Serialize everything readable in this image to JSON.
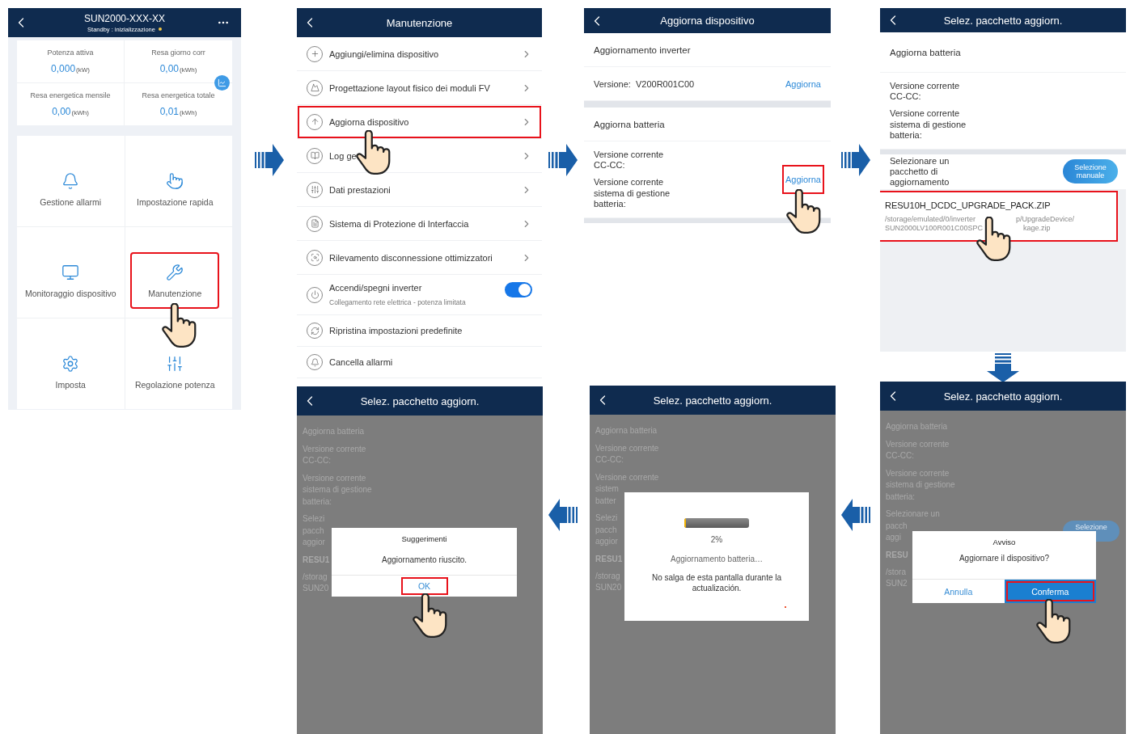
{
  "top_screens": [
    {
      "kind": "home",
      "title": "SUN2000-XXX-XX",
      "subtitle": "Standby : inizializzazione",
      "stats": [
        {
          "label": "Potenza attiva",
          "value": "0,000",
          "unit": "(kW)"
        },
        {
          "label": "Resa giorno corr",
          "value": "0,00",
          "unit": "(kWh)"
        },
        {
          "label": "Resa energetica mensile",
          "value": "0,00",
          "unit": "(kWh)"
        },
        {
          "label": "Resa energetica totale",
          "value": "0,01",
          "unit": "(kWh)"
        }
      ],
      "tiles": [
        {
          "label": "Gestione allarmi",
          "highlighted": false
        },
        {
          "label": "Impostazione rapida",
          "highlighted": false
        },
        {
          "label": "Monitoraggio dispositivo",
          "highlighted": false
        },
        {
          "label": "Manutenzione",
          "highlighted": true
        },
        {
          "label": "Imposta",
          "highlighted": false
        },
        {
          "label": "Regolazione potenza",
          "highlighted": false
        }
      ]
    },
    {
      "kind": "menu",
      "title": "Manutenzione",
      "items": [
        {
          "kind": "link",
          "label": "Aggiungi/elimina dispositivo",
          "highlighted": false
        },
        {
          "kind": "link",
          "label": "Progettazione layout fisico dei moduli FV",
          "highlighted": false
        },
        {
          "kind": "link",
          "label": "Aggiorna dispositivo",
          "highlighted": true
        },
        {
          "kind": "link",
          "label": "Log ge",
          "highlighted": false
        },
        {
          "kind": "link",
          "label": "Dati prestazioni",
          "highlighted": false
        },
        {
          "kind": "link",
          "label": "Sistema di Protezione di Interfaccia",
          "highlighted": false
        },
        {
          "kind": "link",
          "label": "Rilevamento disconnessione ottimizzatori",
          "highlighted": false
        },
        {
          "kind": "toggle",
          "label": "Accendi/spegni inverter",
          "sublabel": "Collegamento rete elettrica - potenza limitata",
          "on": true
        },
        {
          "kind": "plain",
          "label": "Ripristina impostazioni predefinite",
          "highlighted": false
        },
        {
          "kind": "plain",
          "label": "Cancella allarmi",
          "highlighted": false
        }
      ]
    },
    {
      "kind": "update",
      "title": "Aggiorna dispositivo",
      "inverter": {
        "heading": "Aggiornamento inverter",
        "version": "Versione:  V200R001C00",
        "action": "Aggiorna",
        "highlighted": false
      },
      "battery": {
        "heading": "Aggiorna batteria",
        "versions": [
          "Versione corrente CC-CC:",
          "Versione corrente sistema di gestione batteria:"
        ],
        "action": "Aggiorna",
        "highlighted": true
      }
    },
    {
      "kind": "package",
      "title": "Selez. pacchetto aggiorn.",
      "heading": "Aggiorna batteria",
      "versions": [
        "Versione corrente CC-CC:",
        "Versione corrente sistema di gestione batteria:"
      ],
      "prompt": "Selezionare un pacchetto di aggiornamento",
      "button": "Selezione manuale",
      "file": {
        "name": "RESU10H_DCDC_UPGRADE_PACK.ZIP",
        "path_lines": [
          [
            "/storage/emulated/0/inverter",
            "p/UpgradeDevice/"
          ],
          [
            "SUN2000LV100R001C00SPC",
            "kage.zip"
          ]
        ],
        "highlighted": true
      }
    }
  ],
  "bottom_screens": [
    {
      "title": "Selez. pacchetto aggiorn.",
      "background": [
        {
          "kind": "text",
          "lines": [
            "Aggiorna batteria"
          ]
        },
        {
          "kind": "text",
          "lines": [
            "Versione corrente",
            "CC-CC:"
          ]
        },
        {
          "kind": "text",
          "lines": [
            "Versione corrente",
            "sistema di gestione",
            "batteria:"
          ]
        },
        {
          "kind": "text",
          "lines": [
            "Selezi",
            "pacch",
            "aggior"
          ]
        },
        {
          "kind": "file",
          "lines": [
            "RESU1"
          ]
        },
        {
          "kind": "path",
          "lines": [
            "/storag",
            "SUN20"
          ]
        }
      ],
      "dialog": {
        "kind": "message",
        "title": "Suggerimenti",
        "message": "Aggiornamento riuscito.",
        "buttons": [
          {
            "label": "OK",
            "primary": false,
            "highlighted": true
          }
        ]
      }
    },
    {
      "title": "Selez. pacchetto aggiorn.",
      "background": [
        {
          "kind": "text",
          "lines": [
            "Aggiorna batteria"
          ]
        },
        {
          "kind": "text",
          "lines": [
            "Versione corrente",
            "CC-CC:"
          ]
        },
        {
          "kind": "text",
          "lines": [
            "Versione corrente",
            "sistem",
            "batter"
          ]
        },
        {
          "kind": "text",
          "lines": [
            "Selezi",
            "pacch",
            "aggior"
          ]
        },
        {
          "kind": "file",
          "lines": [
            "RESU1"
          ]
        },
        {
          "kind": "path",
          "lines": [
            "/storag",
            "SUN20"
          ]
        }
      ],
      "dialog": {
        "kind": "progress",
        "level": 0.02,
        "percent": "2%",
        "status": "Aggiornamento batteria…",
        "note": "No salga de esta pantalla durante la actualización."
      }
    },
    {
      "title": "Selez. pacchetto aggiorn.",
      "bg_button": "Selezione",
      "background": [
        {
          "kind": "text",
          "lines": [
            "Aggiorna batteria"
          ]
        },
        {
          "kind": "text",
          "lines": [
            "Versione corrente",
            "CC-CC:"
          ]
        },
        {
          "kind": "text",
          "lines": [
            "Versione corrente",
            "sistema di gestione",
            "batteria:"
          ]
        },
        {
          "kind": "text",
          "lines": [
            "Selezionare un",
            "pacch",
            "aggi"
          ]
        },
        {
          "kind": "file",
          "lines": [
            "RESU"
          ]
        },
        {
          "kind": "path",
          "lines": [
            "/stora",
            "SUN2"
          ]
        }
      ],
      "dialog": {
        "kind": "confirm",
        "title": "Avviso",
        "message": "Aggiornare il dispositivo?",
        "buttons": [
          {
            "label": "Annulla",
            "primary": false,
            "highlighted": false
          },
          {
            "label": "Conferma",
            "primary": true,
            "highlighted": true
          }
        ]
      }
    }
  ]
}
